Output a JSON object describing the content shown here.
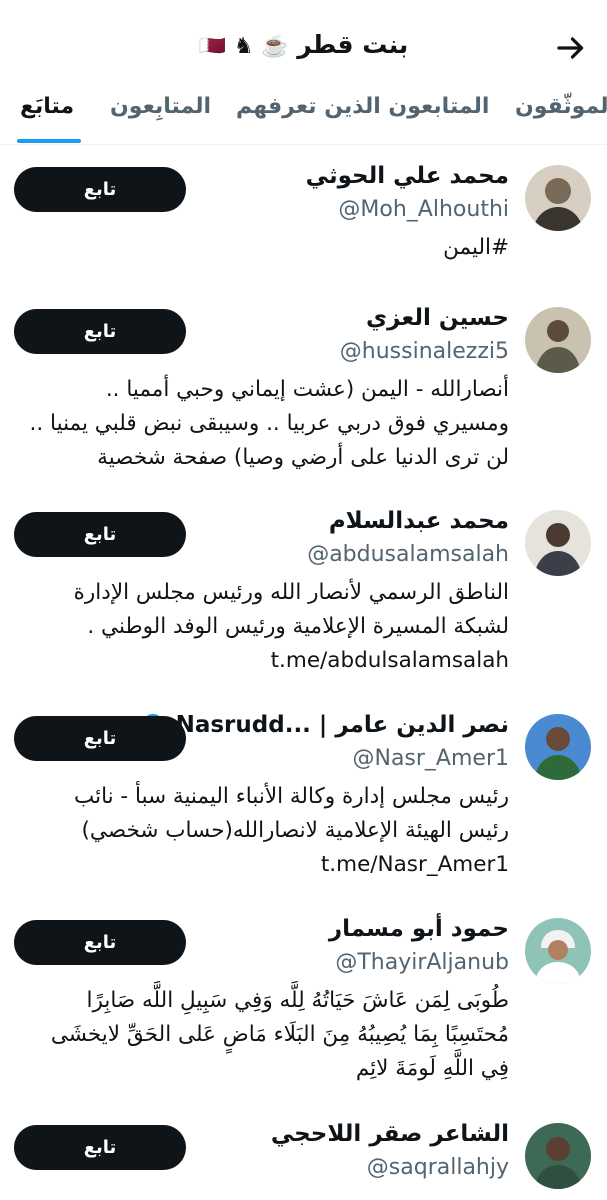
{
  "header": {
    "title": "بنت قطر",
    "emojis": "☕️ ♞ 🇶🇦",
    "back_icon": "arrow-right-icon"
  },
  "tabs": [
    {
      "label": "الموثّقون",
      "active": false
    },
    {
      "label": "المتابعون الذين تعرفهم",
      "active": false
    },
    {
      "label": "المتابِعون",
      "active": false
    },
    {
      "label": "متابَع",
      "active": true
    }
  ],
  "users": [
    {
      "name": "محمد علي الحوثي",
      "handle": "@Moh_Alhouthi",
      "bio": "#اليمن",
      "button": "تابع",
      "verified": false,
      "avatar_color": "#7a6a58"
    },
    {
      "name": "حسين العزي",
      "handle": "@hussinalezzi5",
      "bio": "أنصارالله - اليمن (عشت إيماني وحبي أمميا ..\nومسيري فوق دربي عربيا .. وسيبقى نبض قلبي يمنيا ..\nلن ترى الدنيا على أرضي وصيا) صفحة شخصية",
      "button": "تابع",
      "verified": false,
      "avatar_color": "#5c5a48"
    },
    {
      "name": "محمد عبدالسلام",
      "handle": "@abdusalamsalah",
      "bio": "الناطق الرسمي لأنصار الله ورئيس مجلس الإدارة\nلشبكة المسيرة الإعلامية ورئيس الوفد الوطني .\nt.me/abdulsalamsalah",
      "button": "تابع",
      "verified": false,
      "avatar_color": "#3b3f4a"
    },
    {
      "name": "نصر الدين عامر | ...Nasrudd",
      "handle": "@Nasr_Amer1",
      "bio": "رئيس مجلس إدارة وكالة الأنباء اليمنية سبأ - نائب\nرئيس الهيئة الإعلامية لانصارالله(حساب شخصي)\nt.me/Nasr_Amer1",
      "button": "تابع",
      "verified": true,
      "avatar_color": "#2f6b3a"
    },
    {
      "name": "حمود أبو مسمار",
      "handle": "@ThayirAljanub",
      "bio": "طُوبَى لِمَن عَاشَ حَيَاتُهُ لِلَّه وَفِي سَبِيلِ اللَّه صَابِرًا\nمُحتَسِبًا بِمَا يُصِيبُهُ مِنَ البَلَاء مَاضٍ عَلى الحَقِّ لايخشَى\nفِي اللَّهِ لَومَةَ لائِم",
      "button": "تابع",
      "verified": false,
      "avatar_color": "#7fb3a8"
    },
    {
      "name": "الشاعر صقر اللاحجي",
      "handle": "@saqrallahjy",
      "bio": "",
      "button": "تابع",
      "verified": false,
      "avatar_color": "#2f4f3f"
    }
  ],
  "colors": {
    "accent": "#1d9bf0",
    "text": "#0f1419",
    "secondary": "#536471",
    "button_bg": "#0f1419"
  }
}
